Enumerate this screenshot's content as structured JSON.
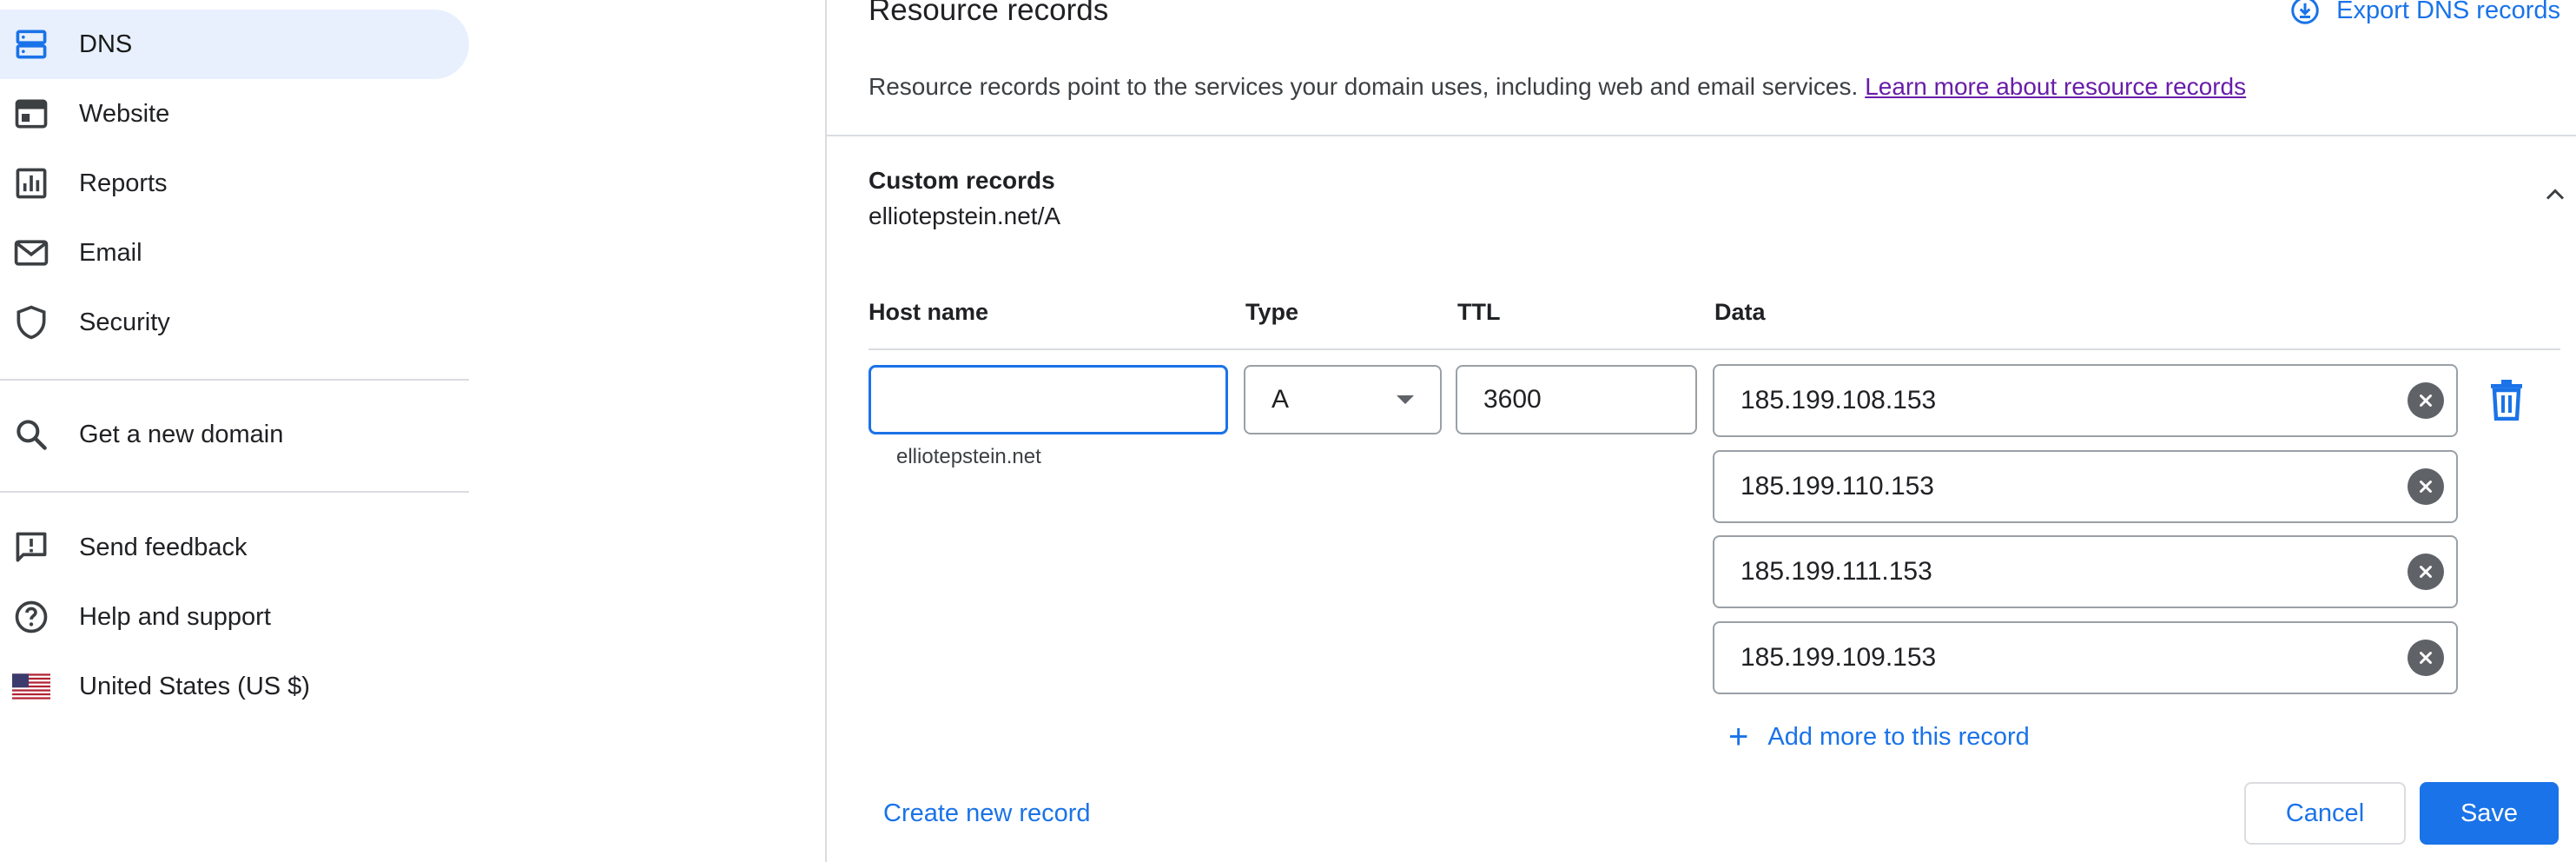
{
  "sidebar": {
    "items": [
      {
        "label": "DNS",
        "icon": "dns-icon",
        "active": true
      },
      {
        "label": "Website",
        "icon": "website-icon"
      },
      {
        "label": "Reports",
        "icon": "reports-icon"
      },
      {
        "label": "Email",
        "icon": "email-icon"
      },
      {
        "label": "Security",
        "icon": "shield-icon"
      }
    ],
    "secondary": [
      {
        "label": "Get a new domain",
        "icon": "search-icon"
      }
    ],
    "footer": [
      {
        "label": "Send feedback",
        "icon": "feedback-icon"
      },
      {
        "label": "Help and support",
        "icon": "help-icon"
      },
      {
        "label": "United States (US $)",
        "icon": "us-flag-icon"
      }
    ]
  },
  "main": {
    "title": "Resource records",
    "export_label": "Export DNS records",
    "description": "Resource records point to the services your domain uses, including web and email services.",
    "learn_more": "Learn more about resource records",
    "custom_records": {
      "title": "Custom records",
      "subtitle": "elliotepstein.net/A",
      "columns": {
        "host": "Host name",
        "type": "Type",
        "ttl": "TTL",
        "data": "Data"
      },
      "row": {
        "host_value": "",
        "host_hint": "elliotepstein.net",
        "type_value": "A",
        "ttl_value": "3600",
        "data_values": [
          "185.199.108.153",
          "185.199.110.153",
          "185.199.111.153",
          "185.199.109.153"
        ]
      },
      "add_more": "Add more to this record",
      "create_new": "Create new record",
      "cancel": "Cancel",
      "save": "Save"
    }
  },
  "colors": {
    "accent": "#1a73e8",
    "active_bg": "#e8f0fe",
    "visited_link": "#681da8",
    "divider": "#dadce0"
  }
}
